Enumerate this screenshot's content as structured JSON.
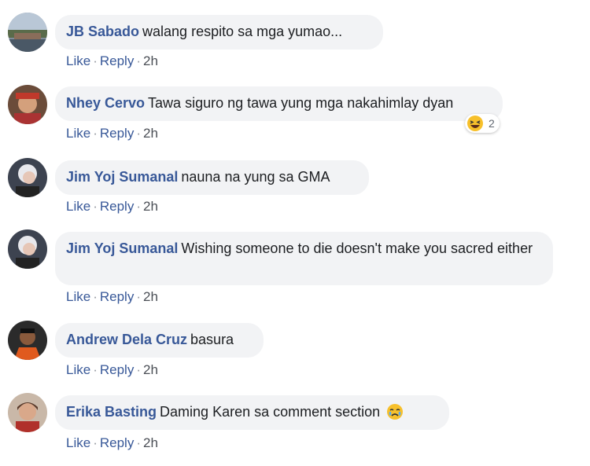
{
  "comments": [
    {
      "author": "JB Sabado",
      "text": "walang respito sa mga yumao...",
      "actions": {
        "like": "Like",
        "reply": "Reply",
        "time": "2h"
      }
    },
    {
      "author": "Nhey Cervo",
      "text": "Tawa siguro ng tawa yung mga nakahimlay dyan",
      "reaction_count": "2",
      "reaction_icon": "laughing-emoji-icon",
      "actions": {
        "like": "Like",
        "reply": "Reply",
        "time": "2h"
      }
    },
    {
      "author": "Jim Yoj Sumanal",
      "text": "nauna na yung sa GMA",
      "actions": {
        "like": "Like",
        "reply": "Reply",
        "time": "2h"
      }
    },
    {
      "author": "Jim Yoj Sumanal",
      "text": "Wishing someone to die doesn't make you sacred either",
      "actions": {
        "like": "Like",
        "reply": "Reply",
        "time": "2h"
      }
    },
    {
      "author": "Andrew Dela Cruz",
      "text": "basura",
      "actions": {
        "like": "Like",
        "reply": "Reply",
        "time": "2h"
      }
    },
    {
      "author": "Erika Basting",
      "text": "Daming Karen sa comment section",
      "emoji_icon": "crying-emoji-icon",
      "actions": {
        "like": "Like",
        "reply": "Reply",
        "time": "2h"
      }
    }
  ],
  "colors": {
    "author": "#385898",
    "bubble": "#f2f3f5",
    "text": "#1c1e21"
  }
}
